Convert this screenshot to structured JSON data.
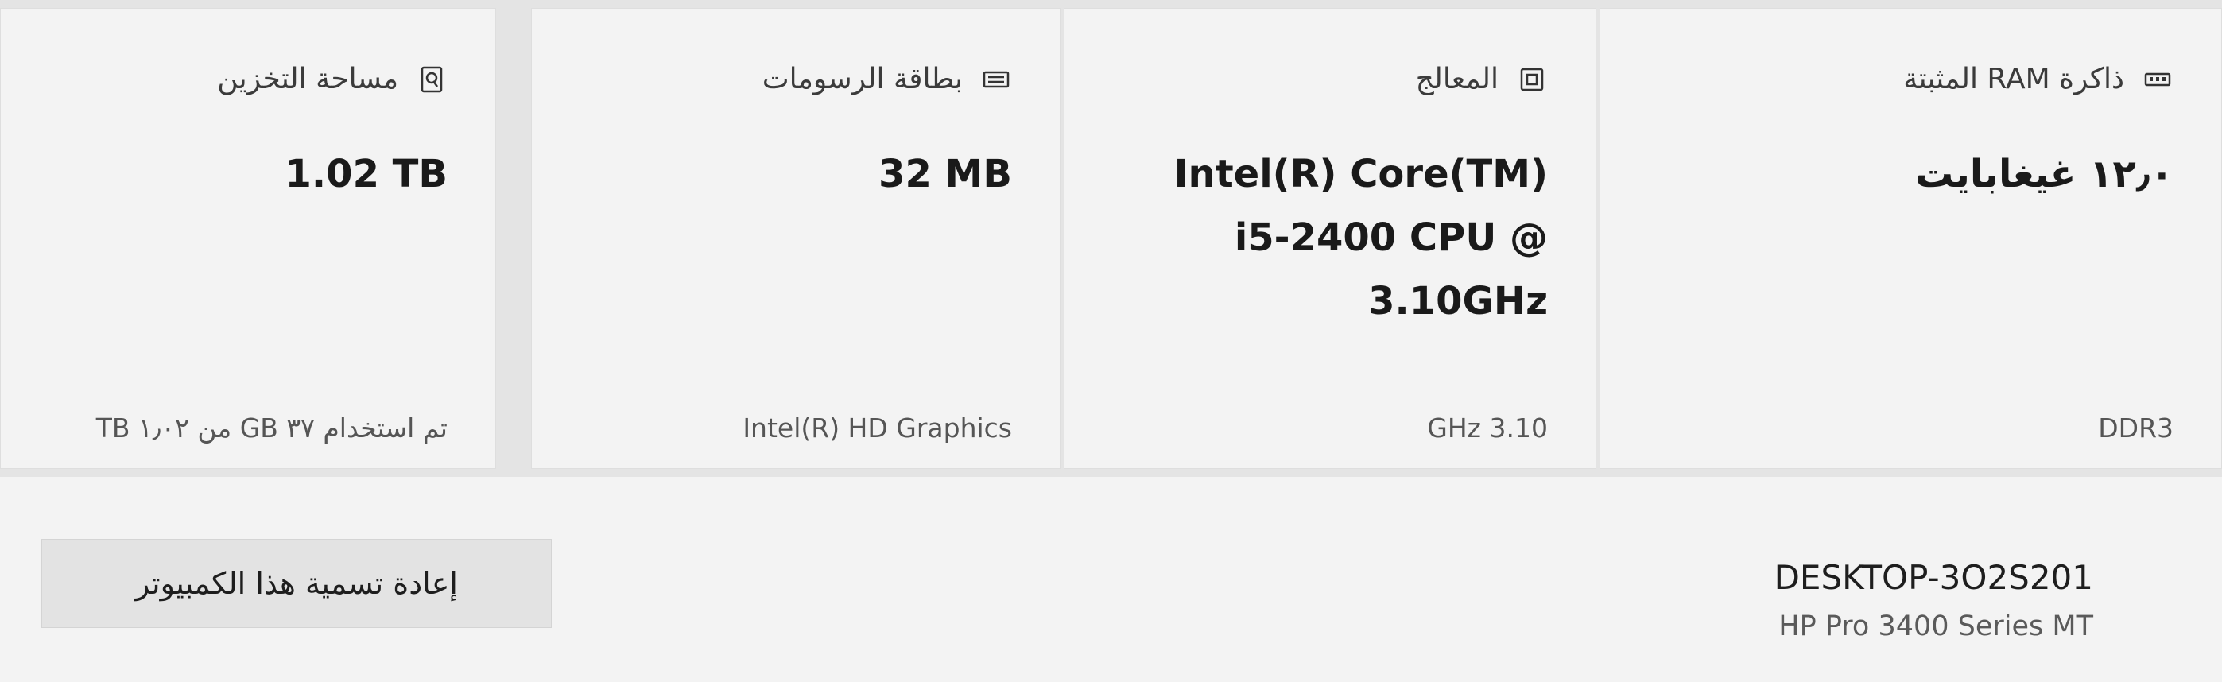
{
  "specs": {
    "ram": {
      "title": "ذاكرة RAM المثبتة",
      "value": "١٢٫٠ غيغابايت",
      "detail": "DDR3",
      "icon": "memory-icon"
    },
    "cpu": {
      "title": "المعالج",
      "value": "Intel(R) Core(TM) i5-2400 CPU @ 3.10GHz",
      "detail": "3.10 GHz",
      "icon": "processor-icon"
    },
    "gpu": {
      "title": "بطاقة الرسومات",
      "value": "32 MB",
      "detail": "Intel(R) HD Graphics",
      "icon": "graphics-card-icon"
    },
    "storage": {
      "title": "مساحة التخزين",
      "value": "1.02 TB",
      "detail": "تم استخدام ٣٧ GB من ١٫٠٢ TB",
      "icon": "storage-icon"
    }
  },
  "device": {
    "name": "DESKTOP-3O2S201",
    "model": "HP Pro 3400 Series MT",
    "rename_label": "إعادة تسمية هذا الكمبيوتر"
  }
}
